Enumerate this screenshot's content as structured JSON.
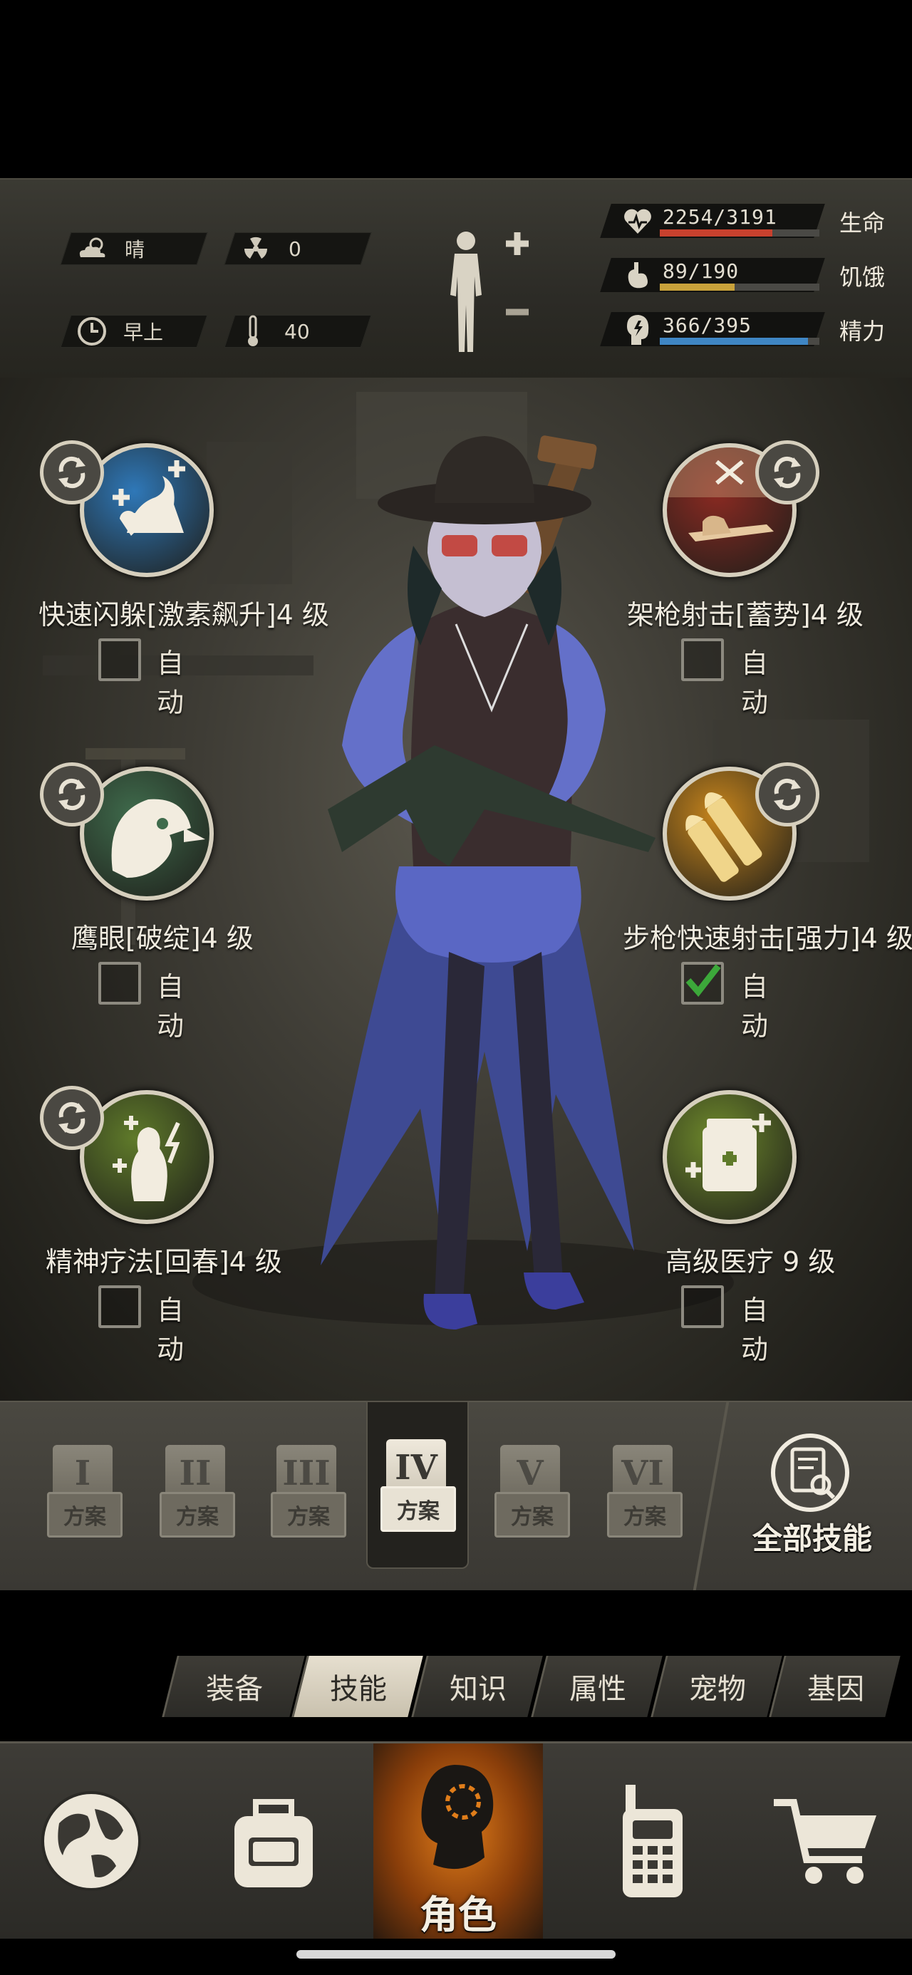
{
  "status": {
    "weather": "晴",
    "radiation": "0",
    "time_of_day": "早上",
    "temperature": "40",
    "stats": [
      {
        "value": "2254/3191",
        "label": "生命",
        "fraction": 0.706,
        "color": "#c8412e"
      },
      {
        "value": "89/190",
        "label": "饥饿",
        "fraction": 0.468,
        "color": "#c9a23b"
      },
      {
        "value": "366/395",
        "label": "精力",
        "fraction": 0.927,
        "color": "#3f86c4"
      }
    ]
  },
  "skills": [
    {
      "name": "快速闪躲[激素飙升]4 级",
      "auto_label": "自动",
      "auto": false,
      "icon": "dodge-icon",
      "color": "#2f78b8"
    },
    {
      "name": "架枪射击[蓄势]4 级",
      "auto_label": "自动",
      "auto": false,
      "icon": "sniper-icon",
      "color": "#8b2a22"
    },
    {
      "name": "鹰眼[破绽]4 级",
      "auto_label": "自动",
      "auto": false,
      "icon": "eagle-icon",
      "color": "#3f6b4c"
    },
    {
      "name": "步枪快速射击[强力]4 级",
      "auto_label": "自动",
      "auto": true,
      "icon": "bullets-icon",
      "color": "#c7851c"
    },
    {
      "name": "精神疗法[回春]4 级",
      "auto_label": "自动",
      "auto": false,
      "icon": "mind-heal-icon",
      "color": "#5f7a2a"
    },
    {
      "name": "高级医疗 9 级",
      "auto_label": "自动",
      "auto": false,
      "icon": "medkit-icon",
      "color": "#6f8a2c"
    }
  ],
  "plans": [
    {
      "numeral": "I",
      "label": "方案",
      "active": false
    },
    {
      "numeral": "II",
      "label": "方案",
      "active": false
    },
    {
      "numeral": "III",
      "label": "方案",
      "active": false
    },
    {
      "numeral": "IV",
      "label": "方案",
      "active": true
    },
    {
      "numeral": "V",
      "label": "方案",
      "active": false
    },
    {
      "numeral": "VI",
      "label": "方案",
      "active": false
    }
  ],
  "all_skills_label": "全部技能",
  "tabs": [
    {
      "label": "装备",
      "active": false
    },
    {
      "label": "技能",
      "active": true
    },
    {
      "label": "知识",
      "active": false
    },
    {
      "label": "属性",
      "active": false
    },
    {
      "label": "宠物",
      "active": false
    },
    {
      "label": "基因",
      "active": false
    }
  ],
  "nav": {
    "items": [
      "globe-icon",
      "backpack-icon",
      "character-icon",
      "radio-icon",
      "cart-icon"
    ],
    "character_label": "角色",
    "active_color": "#e07d1a"
  }
}
